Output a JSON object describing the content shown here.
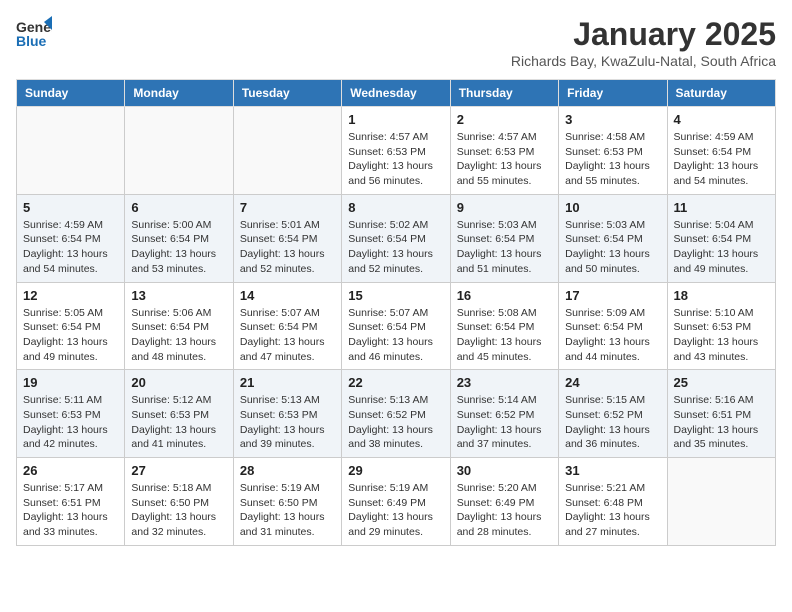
{
  "logo": {
    "general": "General",
    "blue": "Blue"
  },
  "title": "January 2025",
  "location": "Richards Bay, KwaZulu-Natal, South Africa",
  "days_of_week": [
    "Sunday",
    "Monday",
    "Tuesday",
    "Wednesday",
    "Thursday",
    "Friday",
    "Saturday"
  ],
  "weeks": [
    [
      {
        "day": "",
        "info": ""
      },
      {
        "day": "",
        "info": ""
      },
      {
        "day": "",
        "info": ""
      },
      {
        "day": "1",
        "info": "Sunrise: 4:57 AM\nSunset: 6:53 PM\nDaylight: 13 hours\nand 56 minutes."
      },
      {
        "day": "2",
        "info": "Sunrise: 4:57 AM\nSunset: 6:53 PM\nDaylight: 13 hours\nand 55 minutes."
      },
      {
        "day": "3",
        "info": "Sunrise: 4:58 AM\nSunset: 6:53 PM\nDaylight: 13 hours\nand 55 minutes."
      },
      {
        "day": "4",
        "info": "Sunrise: 4:59 AM\nSunset: 6:54 PM\nDaylight: 13 hours\nand 54 minutes."
      }
    ],
    [
      {
        "day": "5",
        "info": "Sunrise: 4:59 AM\nSunset: 6:54 PM\nDaylight: 13 hours\nand 54 minutes."
      },
      {
        "day": "6",
        "info": "Sunrise: 5:00 AM\nSunset: 6:54 PM\nDaylight: 13 hours\nand 53 minutes."
      },
      {
        "day": "7",
        "info": "Sunrise: 5:01 AM\nSunset: 6:54 PM\nDaylight: 13 hours\nand 52 minutes."
      },
      {
        "day": "8",
        "info": "Sunrise: 5:02 AM\nSunset: 6:54 PM\nDaylight: 13 hours\nand 52 minutes."
      },
      {
        "day": "9",
        "info": "Sunrise: 5:03 AM\nSunset: 6:54 PM\nDaylight: 13 hours\nand 51 minutes."
      },
      {
        "day": "10",
        "info": "Sunrise: 5:03 AM\nSunset: 6:54 PM\nDaylight: 13 hours\nand 50 minutes."
      },
      {
        "day": "11",
        "info": "Sunrise: 5:04 AM\nSunset: 6:54 PM\nDaylight: 13 hours\nand 49 minutes."
      }
    ],
    [
      {
        "day": "12",
        "info": "Sunrise: 5:05 AM\nSunset: 6:54 PM\nDaylight: 13 hours\nand 49 minutes."
      },
      {
        "day": "13",
        "info": "Sunrise: 5:06 AM\nSunset: 6:54 PM\nDaylight: 13 hours\nand 48 minutes."
      },
      {
        "day": "14",
        "info": "Sunrise: 5:07 AM\nSunset: 6:54 PM\nDaylight: 13 hours\nand 47 minutes."
      },
      {
        "day": "15",
        "info": "Sunrise: 5:07 AM\nSunset: 6:54 PM\nDaylight: 13 hours\nand 46 minutes."
      },
      {
        "day": "16",
        "info": "Sunrise: 5:08 AM\nSunset: 6:54 PM\nDaylight: 13 hours\nand 45 minutes."
      },
      {
        "day": "17",
        "info": "Sunrise: 5:09 AM\nSunset: 6:54 PM\nDaylight: 13 hours\nand 44 minutes."
      },
      {
        "day": "18",
        "info": "Sunrise: 5:10 AM\nSunset: 6:53 PM\nDaylight: 13 hours\nand 43 minutes."
      }
    ],
    [
      {
        "day": "19",
        "info": "Sunrise: 5:11 AM\nSunset: 6:53 PM\nDaylight: 13 hours\nand 42 minutes."
      },
      {
        "day": "20",
        "info": "Sunrise: 5:12 AM\nSunset: 6:53 PM\nDaylight: 13 hours\nand 41 minutes."
      },
      {
        "day": "21",
        "info": "Sunrise: 5:13 AM\nSunset: 6:53 PM\nDaylight: 13 hours\nand 39 minutes."
      },
      {
        "day": "22",
        "info": "Sunrise: 5:13 AM\nSunset: 6:52 PM\nDaylight: 13 hours\nand 38 minutes."
      },
      {
        "day": "23",
        "info": "Sunrise: 5:14 AM\nSunset: 6:52 PM\nDaylight: 13 hours\nand 37 minutes."
      },
      {
        "day": "24",
        "info": "Sunrise: 5:15 AM\nSunset: 6:52 PM\nDaylight: 13 hours\nand 36 minutes."
      },
      {
        "day": "25",
        "info": "Sunrise: 5:16 AM\nSunset: 6:51 PM\nDaylight: 13 hours\nand 35 minutes."
      }
    ],
    [
      {
        "day": "26",
        "info": "Sunrise: 5:17 AM\nSunset: 6:51 PM\nDaylight: 13 hours\nand 33 minutes."
      },
      {
        "day": "27",
        "info": "Sunrise: 5:18 AM\nSunset: 6:50 PM\nDaylight: 13 hours\nand 32 minutes."
      },
      {
        "day": "28",
        "info": "Sunrise: 5:19 AM\nSunset: 6:50 PM\nDaylight: 13 hours\nand 31 minutes."
      },
      {
        "day": "29",
        "info": "Sunrise: 5:19 AM\nSunset: 6:49 PM\nDaylight: 13 hours\nand 29 minutes."
      },
      {
        "day": "30",
        "info": "Sunrise: 5:20 AM\nSunset: 6:49 PM\nDaylight: 13 hours\nand 28 minutes."
      },
      {
        "day": "31",
        "info": "Sunrise: 5:21 AM\nSunset: 6:48 PM\nDaylight: 13 hours\nand 27 minutes."
      },
      {
        "day": "",
        "info": ""
      }
    ]
  ]
}
